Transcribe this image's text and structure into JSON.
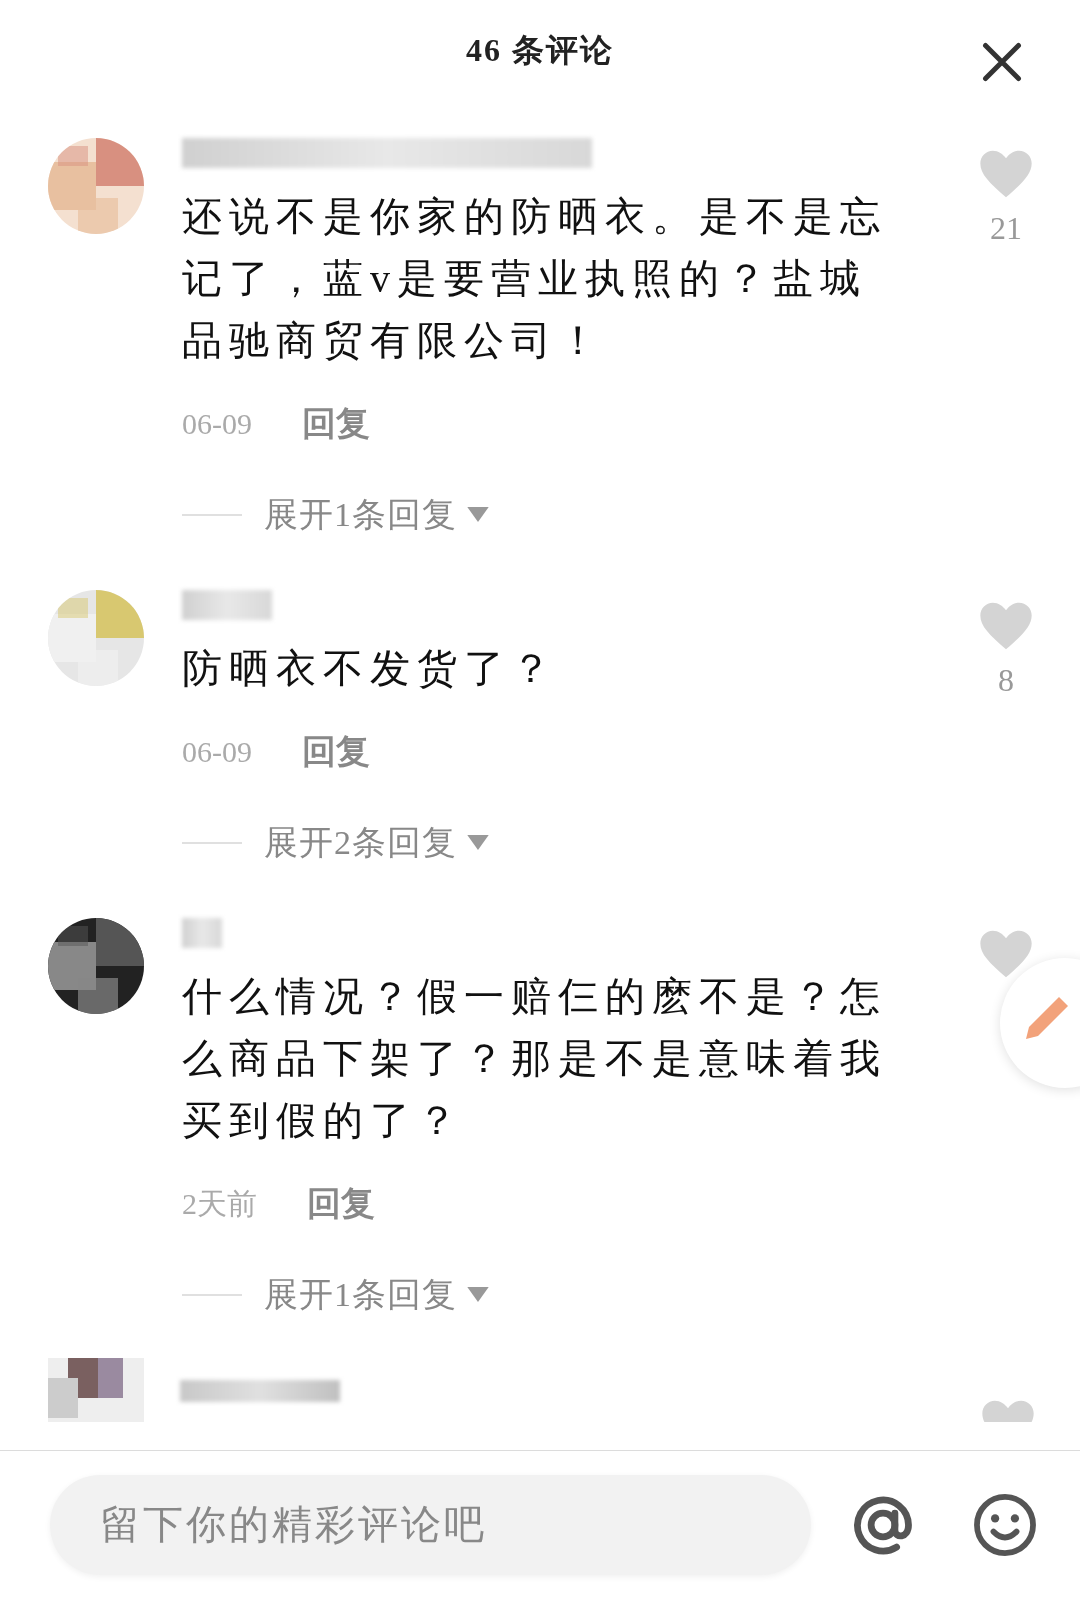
{
  "header": {
    "title": "46 条评论"
  },
  "comments": [
    {
      "text": "还说不是你家的防晒衣。是不是忘记了，蓝v是要营业执照的？盐城品驰商贸有限公司！",
      "time": "06-09",
      "reply": "回复",
      "expand": "展开1条回复",
      "likes": "21"
    },
    {
      "text": "防晒衣不发货了？",
      "time": "06-09",
      "reply": "回复",
      "expand": "展开2条回复",
      "likes": "8"
    },
    {
      "text": "什么情况？假一赔仨的麽不是？怎么商品下架了？那是不是意味着我买到假的了？",
      "time": "2天前",
      "reply": "回复",
      "expand": "展开1条回复"
    }
  ],
  "input": {
    "placeholder": "留下你的精彩评论吧"
  }
}
